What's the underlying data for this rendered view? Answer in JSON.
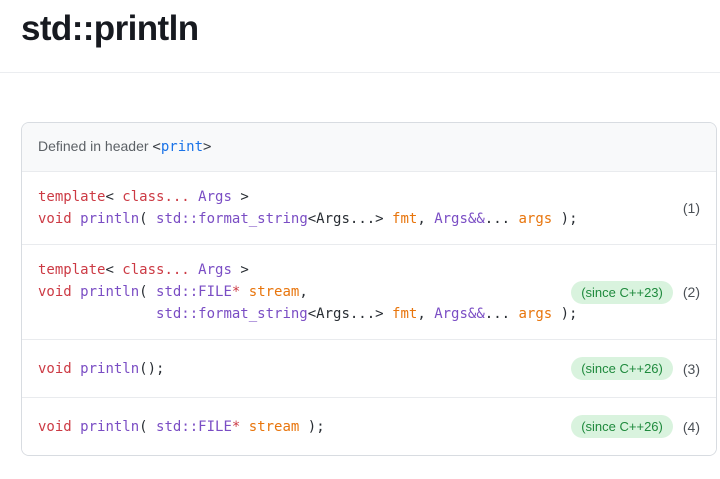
{
  "page": {
    "title": "std::println"
  },
  "header_row": {
    "prefix": "Defined in header ",
    "lt": "<",
    "header_name": "print",
    "gt": ">"
  },
  "colors": {
    "keyword_red": "#cc3a44",
    "type_purple": "#7a4dc4",
    "param_orange": "#e8750c",
    "plain_code": "#282d33",
    "badge_bg_green": "#d9f3de",
    "badge_text_green": "#1f8a3d",
    "link_blue": "#1a73e8",
    "header_row_bg": "#f8f9fa",
    "box_border": "#d8dce1"
  },
  "declarations": [
    {
      "number": "(1)",
      "badge": null,
      "lines": [
        [
          {
            "c": "kw",
            "t": "template"
          },
          {
            "c": "plain",
            "t": "< "
          },
          {
            "c": "kw",
            "t": "class..."
          },
          {
            "c": "plain",
            "t": " "
          },
          {
            "c": "type",
            "t": "Args"
          },
          {
            "c": "plain",
            "t": " >"
          }
        ],
        [
          {
            "c": "kw",
            "t": "void"
          },
          {
            "c": "plain",
            "t": " "
          },
          {
            "c": "type",
            "t": "println"
          },
          {
            "c": "plain",
            "t": "( "
          },
          {
            "c": "type",
            "t": "std::format_string"
          },
          {
            "c": "plain",
            "t": "<Args...> "
          },
          {
            "c": "param",
            "t": "fmt"
          },
          {
            "c": "plain",
            "t": ", "
          },
          {
            "c": "type",
            "t": "Args&&"
          },
          {
            "c": "plain",
            "t": "... "
          },
          {
            "c": "param",
            "t": "args"
          },
          {
            "c": "plain",
            "t": " );"
          }
        ]
      ]
    },
    {
      "number": "(2)",
      "badge": "(since C++23)",
      "lines": [
        [
          {
            "c": "kw",
            "t": "template"
          },
          {
            "c": "plain",
            "t": "< "
          },
          {
            "c": "kw",
            "t": "class..."
          },
          {
            "c": "plain",
            "t": " "
          },
          {
            "c": "type",
            "t": "Args"
          },
          {
            "c": "plain",
            "t": " >"
          }
        ],
        [
          {
            "c": "kw",
            "t": "void"
          },
          {
            "c": "plain",
            "t": " "
          },
          {
            "c": "type",
            "t": "println"
          },
          {
            "c": "plain",
            "t": "( "
          },
          {
            "c": "type",
            "t": "std::FILE"
          },
          {
            "c": "kw",
            "t": "*"
          },
          {
            "c": "plain",
            "t": " "
          },
          {
            "c": "param",
            "t": "stream"
          },
          {
            "c": "plain",
            "t": ","
          }
        ],
        [
          {
            "c": "plain",
            "t": "              "
          },
          {
            "c": "type",
            "t": "std::format_string"
          },
          {
            "c": "plain",
            "t": "<Args...> "
          },
          {
            "c": "param",
            "t": "fmt"
          },
          {
            "c": "plain",
            "t": ", "
          },
          {
            "c": "type",
            "t": "Args&&"
          },
          {
            "c": "plain",
            "t": "... "
          },
          {
            "c": "param",
            "t": "args"
          },
          {
            "c": "plain",
            "t": " );"
          }
        ]
      ]
    },
    {
      "number": "(3)",
      "badge": "(since C++26)",
      "lines": [
        [
          {
            "c": "kw",
            "t": "void"
          },
          {
            "c": "plain",
            "t": " "
          },
          {
            "c": "type",
            "t": "println"
          },
          {
            "c": "plain",
            "t": "();"
          }
        ]
      ]
    },
    {
      "number": "(4)",
      "badge": "(since C++26)",
      "lines": [
        [
          {
            "c": "kw",
            "t": "void"
          },
          {
            "c": "plain",
            "t": " "
          },
          {
            "c": "type",
            "t": "println"
          },
          {
            "c": "plain",
            "t": "( "
          },
          {
            "c": "type",
            "t": "std::FILE"
          },
          {
            "c": "kw",
            "t": "*"
          },
          {
            "c": "plain",
            "t": " "
          },
          {
            "c": "param",
            "t": "stream"
          },
          {
            "c": "plain",
            "t": " );"
          }
        ]
      ]
    }
  ]
}
